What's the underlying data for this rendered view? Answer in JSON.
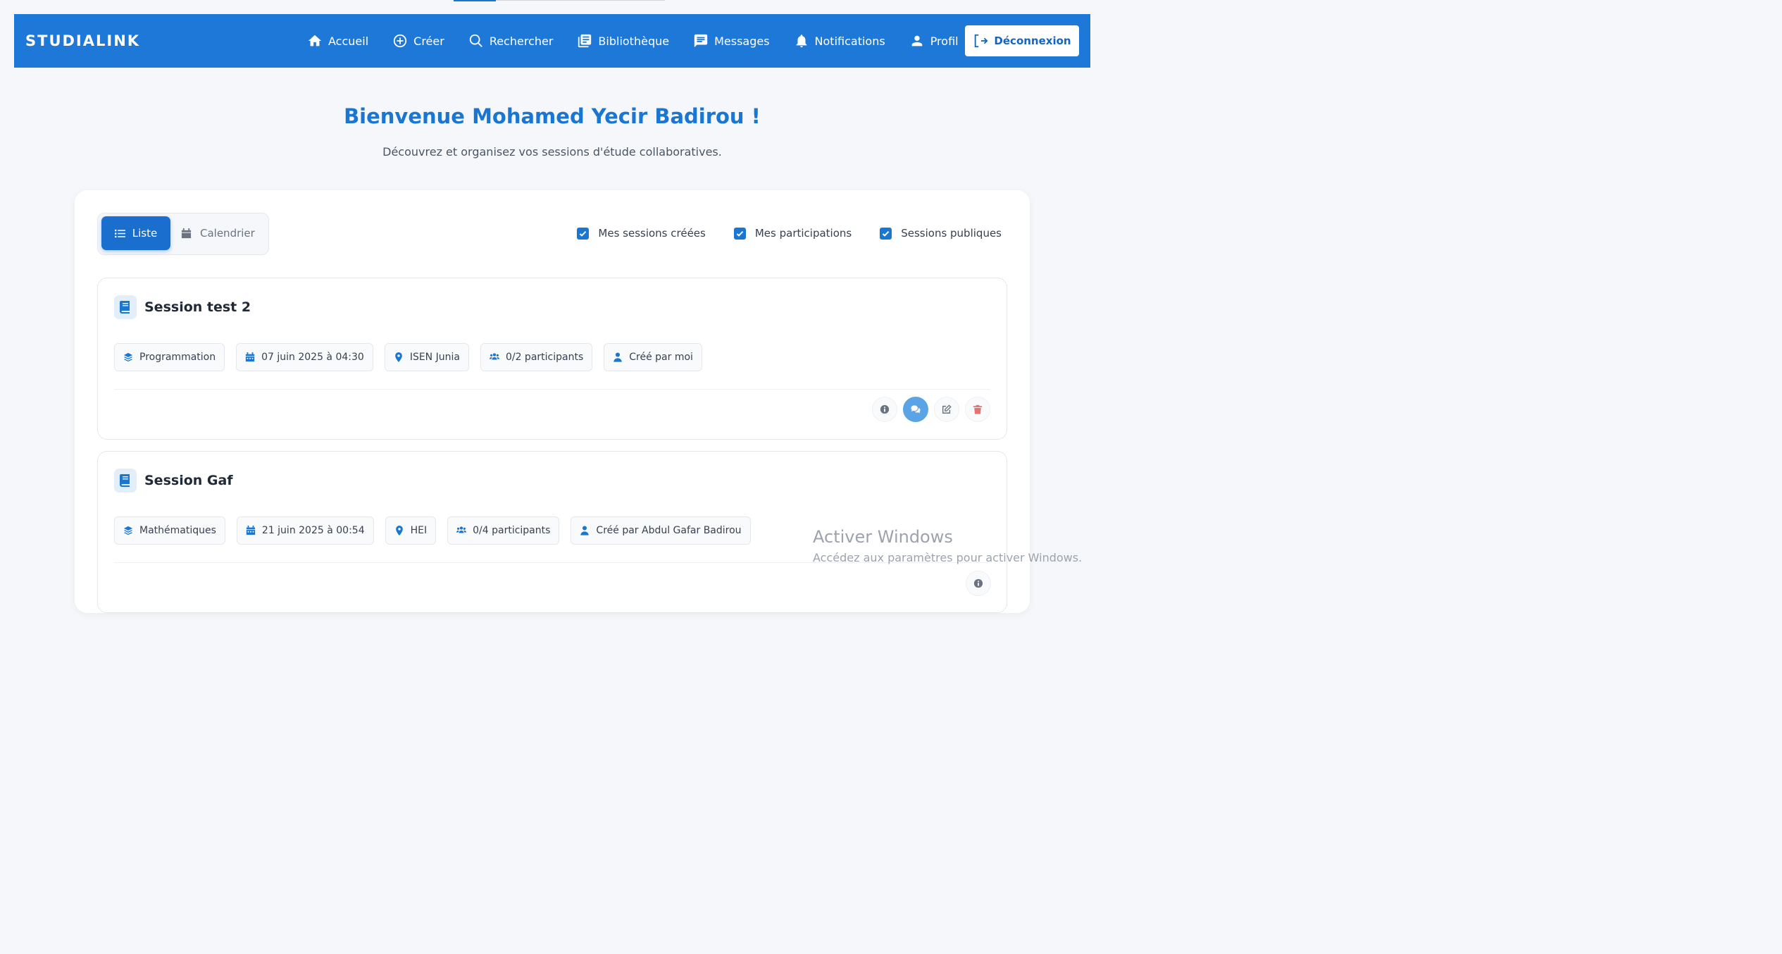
{
  "navbar": {
    "brand": "STUDIALINK",
    "items": [
      {
        "label": "Accueil",
        "icon": "home-icon"
      },
      {
        "label": "Créer",
        "icon": "plus-circle-icon"
      },
      {
        "label": "Rechercher",
        "icon": "search-icon"
      },
      {
        "label": "Bibliothèque",
        "icon": "library-icon"
      },
      {
        "label": "Messages",
        "icon": "message-icon"
      },
      {
        "label": "Notifications",
        "icon": "bell-icon"
      },
      {
        "label": "Profil",
        "icon": "user-icon"
      }
    ],
    "logout_label": "Déconnexion"
  },
  "header": {
    "welcome": "Bienvenue Mohamed Yecir Badirou !",
    "subtitle": "Découvrez et organisez vos sessions d'étude collaboratives."
  },
  "view_toggle": {
    "list_label": "Liste",
    "calendar_label": "Calendrier",
    "active": "Liste"
  },
  "filters": [
    {
      "label": "Mes sessions créées",
      "checked": true
    },
    {
      "label": "Mes participations",
      "checked": true
    },
    {
      "label": "Sessions publiques",
      "checked": true
    }
  ],
  "sessions": [
    {
      "title": "Session test 2",
      "subject": "Programmation",
      "date": "07 juin 2025 à 04:30",
      "location": "ISEN Junia",
      "participants": "0/2 participants",
      "creator": "Créé par moi"
    },
    {
      "title": "Session Gaf",
      "subject": "Mathématiques",
      "date": "21 juin 2025 à 00:54",
      "location": "HEI",
      "participants": "0/4 participants",
      "creator": "Créé par Abdul Gafar Badirou"
    }
  ],
  "colors": {
    "primary": "#1e78d8",
    "accent": "#1976d2",
    "delete": "#e57373",
    "background": "#f5f7fa"
  },
  "watermark": {
    "title": "Activer Windows",
    "subtitle": "Accédez aux paramètres pour activer Windows."
  }
}
